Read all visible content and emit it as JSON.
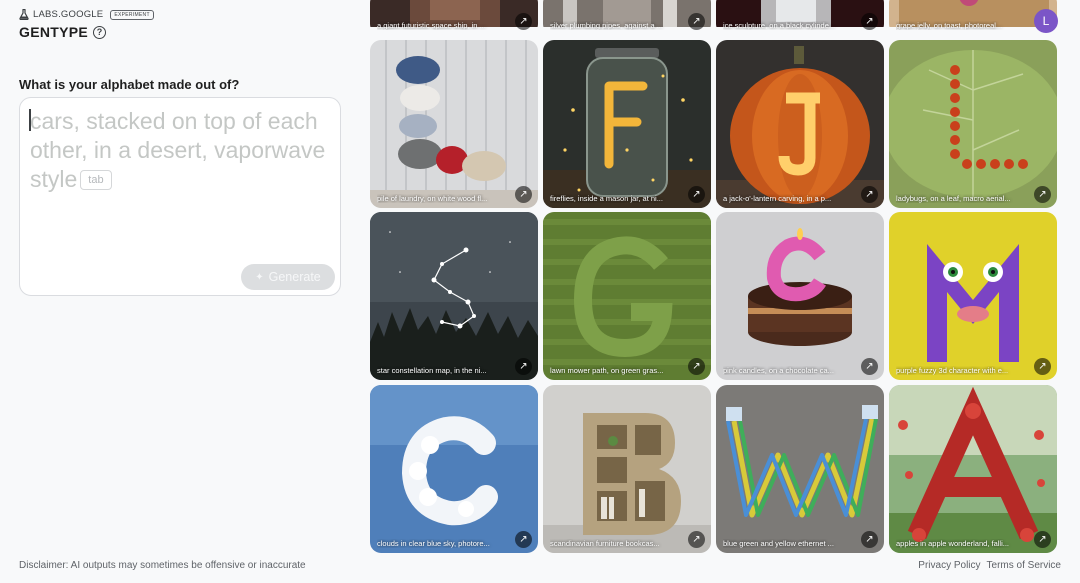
{
  "brand": {
    "labs": "LABS.GOOGLE",
    "badge": "EXPERIMENT",
    "app_name": "GENTYPE",
    "help": "?"
  },
  "prompt": {
    "question": "What is your alphabet made out of?",
    "placeholder": "cars, stacked on top of each other, in a desert, vaporwave style",
    "tab_hint": "tab",
    "generate_label": "Generate"
  },
  "user": {
    "avatar_initial": "L"
  },
  "footer": {
    "disclaimer": "Disclaimer: AI outputs may sometimes be offensive or inaccurate",
    "privacy": "Privacy Policy",
    "terms": "Terms of Service"
  },
  "gallery": [
    {
      "letter": "",
      "caption": "a giant futuristic space ship, in ..."
    },
    {
      "letter": "",
      "caption": "silver plumbing pipes, against a ..."
    },
    {
      "letter": "",
      "caption": "ice sculpture, on a black cylinde..."
    },
    {
      "letter": "",
      "caption": "grape jelly, on toast, photoreal..."
    },
    {
      "letter": "L",
      "caption": "pile of laundry, on white wood fl..."
    },
    {
      "letter": "F",
      "caption": "fireflies, inside a mason jar, at ni..."
    },
    {
      "letter": "J",
      "caption": "a jack-o'-lantern carving, in a p..."
    },
    {
      "letter": "L",
      "caption": "ladybugs, on a leaf, macro aerial..."
    },
    {
      "letter": "S",
      "caption": "star constellation map, in the ni..."
    },
    {
      "letter": "G",
      "caption": "lawn mower path, on green gras..."
    },
    {
      "letter": "C",
      "caption": "pink candles, on a chocolate ca..."
    },
    {
      "letter": "M",
      "caption": "purple fuzzy 3d character with e..."
    },
    {
      "letter": "C",
      "caption": "clouds in clear blue sky, photore..."
    },
    {
      "letter": "B",
      "caption": "scandinavian furniture bookcas..."
    },
    {
      "letter": "W",
      "caption": "blue green and yellow ethernet ..."
    },
    {
      "letter": "A",
      "caption": "apples in apple wonderland, falli..."
    }
  ],
  "icons": {
    "open": "arrow-up-right-icon",
    "spark": "sparkle-icon",
    "help": "help-circle-icon",
    "brand": "flask-icon"
  }
}
